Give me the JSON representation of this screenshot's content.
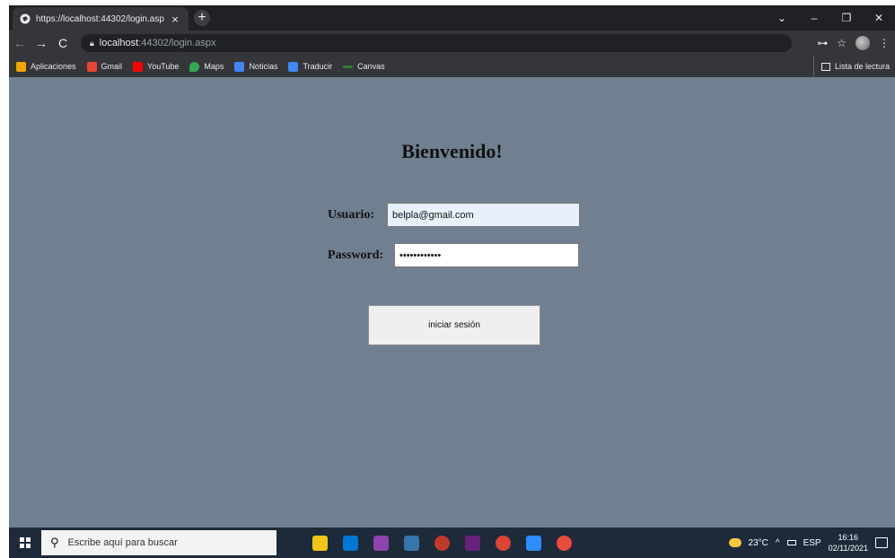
{
  "browser": {
    "tab_title": "https://localhost:44302/login.asp",
    "tab_close": "×",
    "new_tab": "+",
    "address": {
      "host": "localhost",
      "path": ":44302/login.aspx"
    },
    "window_controls": {
      "tabs_menu": "⌄",
      "minimize": "–",
      "restore": "❐",
      "close": "✕"
    },
    "nav": {
      "back": "←",
      "forward": "→",
      "reload": "C"
    },
    "right_tools": {
      "key": "⊶",
      "star": "☆",
      "menu": "⋮"
    }
  },
  "bookmarks": {
    "items": [
      {
        "label": "Aplicaciones",
        "icon": "apps-grid-icon",
        "color": "#f2a600"
      },
      {
        "label": "Gmail",
        "icon": "gmail-icon",
        "color": "#ea4335"
      },
      {
        "label": "YouTube",
        "icon": "youtube-icon",
        "color": "#ff0000"
      },
      {
        "label": "Maps",
        "icon": "maps-pin-icon",
        "color": "#34a853"
      },
      {
        "label": "Noticias",
        "icon": "news-icon",
        "color": "#4285f4"
      },
      {
        "label": "Traducir",
        "icon": "translate-icon",
        "color": "#4285f4"
      },
      {
        "label": "Canvas",
        "icon": "canvas-icon",
        "color": "#2e7d32"
      }
    ],
    "reading_list": "Lista de lectura"
  },
  "page": {
    "title": "Bienvenido!",
    "user_label": "Usuario:",
    "user_value": "belpla@gmail.com",
    "password_label": "Password:",
    "password_value": "••••••••••••",
    "submit_label": "iniciar sesión",
    "background": "#708090"
  },
  "taskbar": {
    "search_placeholder": "Escribe aquí para buscar",
    "apps": [
      {
        "name": "file-explorer",
        "color": "#f0c419"
      },
      {
        "name": "mail",
        "color": "#0078d4"
      },
      {
        "name": "winrar",
        "color": "#8e44ad"
      },
      {
        "name": "python",
        "color": "#3776ab"
      },
      {
        "name": "network",
        "color": "#c0392b"
      },
      {
        "name": "visual-studio",
        "color": "#68217a"
      },
      {
        "name": "chrome",
        "color": "#db4437"
      },
      {
        "name": "zoom",
        "color": "#2d8cff"
      },
      {
        "name": "tool",
        "color": "#e74c3c"
      }
    ],
    "weather": "23°C",
    "tray_arrow": "^",
    "language": "ESP",
    "time": "16:16",
    "date": "02/11/2021"
  }
}
